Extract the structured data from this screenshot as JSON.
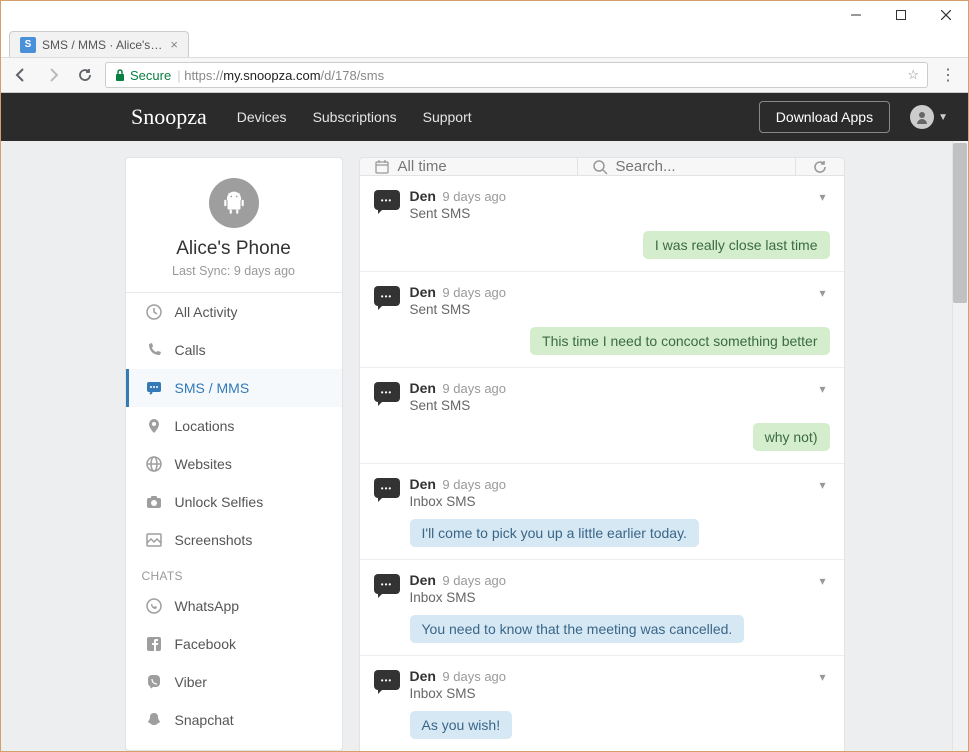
{
  "window": {
    "tab_title": "SMS / MMS · Alice's Pho"
  },
  "browser": {
    "secure_label": "Secure",
    "url_host": "https://",
    "url_domain": "my.snoopza.com",
    "url_path": "/d/178/sms"
  },
  "header": {
    "logo": "Snoopza",
    "nav": {
      "devices": "Devices",
      "subscriptions": "Subscriptions",
      "support": "Support"
    },
    "download": "Download Apps"
  },
  "device": {
    "name": "Alice's Phone",
    "last_sync": "Last Sync: 9 days ago"
  },
  "sidebar": {
    "items": [
      {
        "label": "All Activity"
      },
      {
        "label": "Calls"
      },
      {
        "label": "SMS / MMS"
      },
      {
        "label": "Locations"
      },
      {
        "label": "Websites"
      },
      {
        "label": "Unlock Selfies"
      },
      {
        "label": "Screenshots"
      }
    ],
    "chats_heading": "CHATS",
    "chats": [
      {
        "label": "WhatsApp"
      },
      {
        "label": "Facebook"
      },
      {
        "label": "Viber"
      },
      {
        "label": "Snapchat"
      }
    ]
  },
  "filters": {
    "time": "All time",
    "search_placeholder": "Search..."
  },
  "messages": [
    {
      "contact": "Den",
      "time": "9 days ago",
      "type": "Sent SMS",
      "dir": "sent",
      "text": "I was really close last time"
    },
    {
      "contact": "Den",
      "time": "9 days ago",
      "type": "Sent SMS",
      "dir": "sent",
      "text": "This time I need to concoct something better"
    },
    {
      "contact": "Den",
      "time": "9 days ago",
      "type": "Sent SMS",
      "dir": "sent",
      "text": "why not)"
    },
    {
      "contact": "Den",
      "time": "9 days ago",
      "type": "Inbox SMS",
      "dir": "inbox",
      "text": "I'll come to pick you up a little earlier today."
    },
    {
      "contact": "Den",
      "time": "9 days ago",
      "type": "Inbox SMS",
      "dir": "inbox",
      "text": "You need to know that the meeting was cancelled."
    },
    {
      "contact": "Den",
      "time": "9 days ago",
      "type": "Inbox SMS",
      "dir": "inbox",
      "text": "As you wish!"
    }
  ]
}
